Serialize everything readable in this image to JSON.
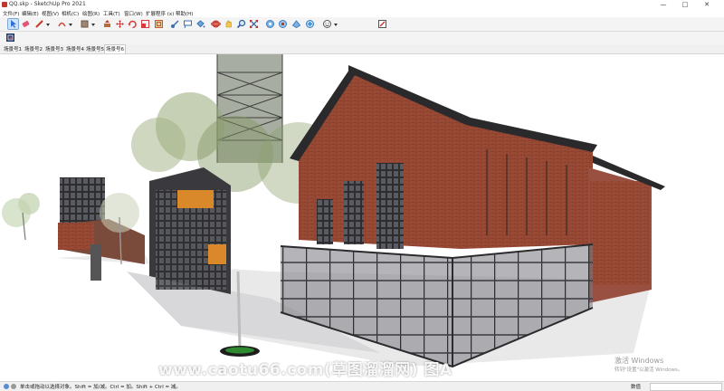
{
  "window": {
    "title": "QQ.skp - SketchUp Pro 2021",
    "minimize_glyph": "—",
    "maximize_glyph": "□",
    "close_glyph": "✕"
  },
  "menu": {
    "items": [
      "文件(F)",
      "编辑(E)",
      "视图(V)",
      "相机(C)",
      "绘图(R)",
      "工具(T)",
      "窗口(W)",
      "扩展程序 (x)",
      "帮助(H)"
    ]
  },
  "toolbar": {
    "tools": [
      {
        "name": "select-tool",
        "color": "#2f6fd6"
      },
      {
        "name": "eraser-tool",
        "color": "#e0557a"
      },
      {
        "name": "line-tool",
        "color": "#c0392b"
      },
      {
        "name": "arc-tool",
        "color": "#d04a3a"
      },
      {
        "name": "shape-tool",
        "color": "#8a6d5a"
      },
      {
        "name": "pushpull-tool",
        "color": "#c0392b"
      },
      {
        "name": "move-tool",
        "color": "#d93b3b"
      },
      {
        "name": "rotate-tool",
        "color": "#d93b3b"
      },
      {
        "name": "scale-tool",
        "color": "#d93b3b"
      },
      {
        "name": "offset-tool",
        "color": "#c85a2a"
      },
      {
        "name": "tape-measure-tool",
        "color": "#3a6fb0"
      },
      {
        "name": "text-tool",
        "color": "#3a6fb0"
      },
      {
        "name": "paint-bucket-tool",
        "color": "#3a6fb0"
      },
      {
        "name": "orbit-tool",
        "color": "#c0392b"
      },
      {
        "name": "pan-tool",
        "color": "#d6a52a"
      },
      {
        "name": "zoom-tool",
        "color": "#2a5aa0"
      },
      {
        "name": "zoom-extents-tool",
        "color": "#c0392b"
      },
      {
        "name": "warehouse-tool",
        "color": "#3a7fc0"
      },
      {
        "name": "extension-warehouse-tool",
        "color": "#3a7fc0"
      },
      {
        "name": "send-to-layout-tool",
        "color": "#3a7fc0"
      },
      {
        "name": "extension-manager-tool",
        "color": "#3a7fc0"
      },
      {
        "name": "profile-tool",
        "color": "#555555"
      },
      {
        "name": "edit-tool",
        "color": "#c0392b"
      }
    ]
  },
  "tabs": {
    "items": [
      "场景号1",
      "场景号2",
      "场景号3",
      "场景号4",
      "场景号5",
      "场景号6"
    ],
    "active_index": 5
  },
  "status": {
    "text": "单击或拖动以选择对象。Shift = 加/减。Ctrl = 加。Shift + Ctrl = 减。",
    "measure_label": "数值"
  },
  "watermark": "www.caotu66.com(草图溜溜网) 图A",
  "activation": {
    "line1": "激活 Windows",
    "line2": "转到\"设置\"以激活 Windows。"
  }
}
